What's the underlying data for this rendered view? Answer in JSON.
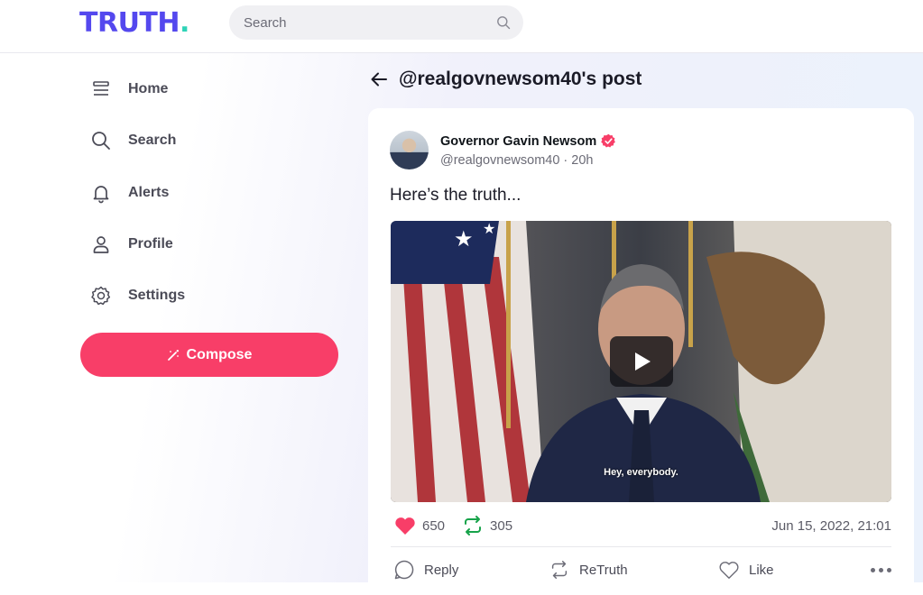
{
  "brand": {
    "logo_text": "TRUTH",
    "logo_dot": ".",
    "logo_color": "#5448ee",
    "dot_color": "#2ed3b7"
  },
  "search": {
    "placeholder": "Search"
  },
  "nav": {
    "items": [
      {
        "label": "Home",
        "icon": "home-icon"
      },
      {
        "label": "Search",
        "icon": "search-icon"
      },
      {
        "label": "Alerts",
        "icon": "bell-icon"
      },
      {
        "label": "Profile",
        "icon": "user-icon"
      },
      {
        "label": "Settings",
        "icon": "gear-icon"
      }
    ],
    "compose_label": "Compose",
    "compose_color": "#f83e68"
  },
  "header": {
    "title": "@realgovnewsom40's post"
  },
  "post": {
    "author_name": "Governor Gavin Newsom",
    "handle_time": "@realgovnewsom40 · 20h",
    "text": "Here’s the truth...",
    "video_caption": "Hey, everybody.",
    "likes": "650",
    "retruths": "305",
    "date": "Jun 15, 2022, 21:01",
    "like_color": "#f83e68",
    "retruth_color": "#17a34a"
  },
  "actions": {
    "reply": "Reply",
    "retruth": "ReTruth",
    "like": "Like"
  }
}
